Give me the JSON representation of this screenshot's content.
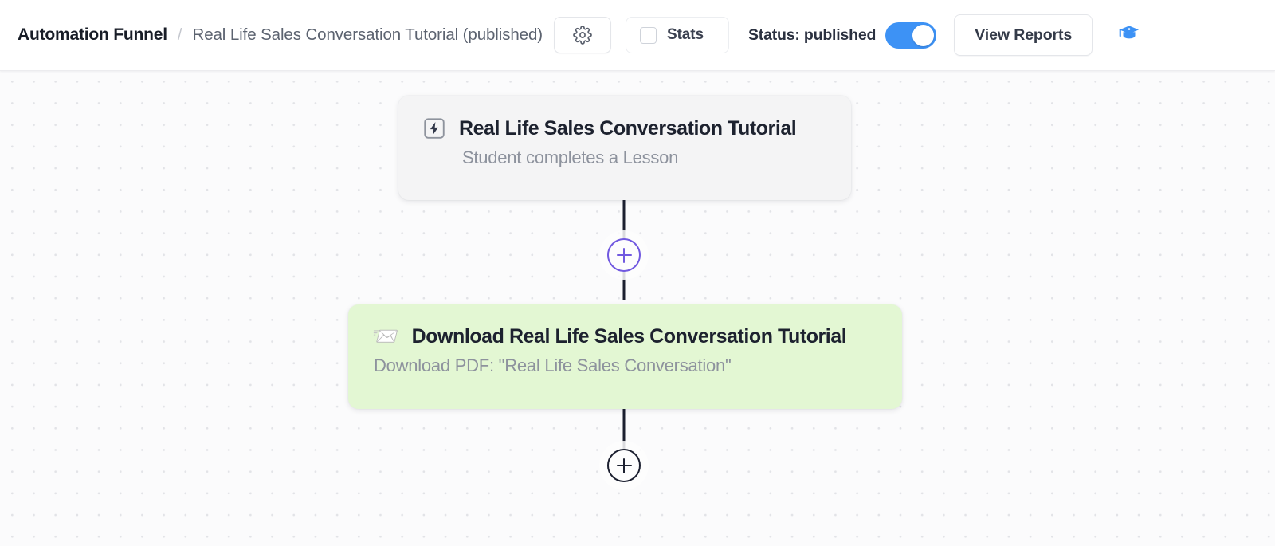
{
  "header": {
    "breadcrumb": {
      "root": "Automation Funnel",
      "separator": "/",
      "leaf": "Real Life Sales Conversation Tutorial (published)"
    },
    "settings_button": {
      "icon": "gear-icon",
      "label": ""
    },
    "stats_button": {
      "label": "Stats",
      "checked": false,
      "checkbox_icon": "checkbox-unchecked-icon"
    },
    "status": {
      "label": "Status: published",
      "toggle_on": true,
      "toggle_color": "#3d92f5"
    },
    "view_reports_button": {
      "label": "View Reports"
    },
    "help_button": {
      "icon": "graduation-cap-icon",
      "color": "#3d92f5"
    }
  },
  "canvas": {
    "background_color": "#fbfbfc",
    "dot_color": "#e2e3e7",
    "connector_color": "#1c2030",
    "nodes": [
      {
        "id": "trigger",
        "type": "trigger",
        "icon": "lightning-bolt-icon",
        "title": "Real Life Sales Conversation Tutorial",
        "subtitle": "Student completes a Lesson",
        "background_color": "#f4f4f5"
      },
      {
        "id": "action",
        "type": "action",
        "icon": "incoming-envelope-icon",
        "icon_glyph": "📨",
        "title": "Download Real Life Sales Conversation Tutorial",
        "subtitle": "Download PDF: \"Real Life Sales Conversation\"",
        "background_color": "#e3f7d3"
      }
    ],
    "add_buttons": [
      {
        "id": "add-step-1",
        "label": "+",
        "color": "#7159e0"
      },
      {
        "id": "add-step-2",
        "label": "+",
        "color": "#1c2030"
      }
    ]
  }
}
